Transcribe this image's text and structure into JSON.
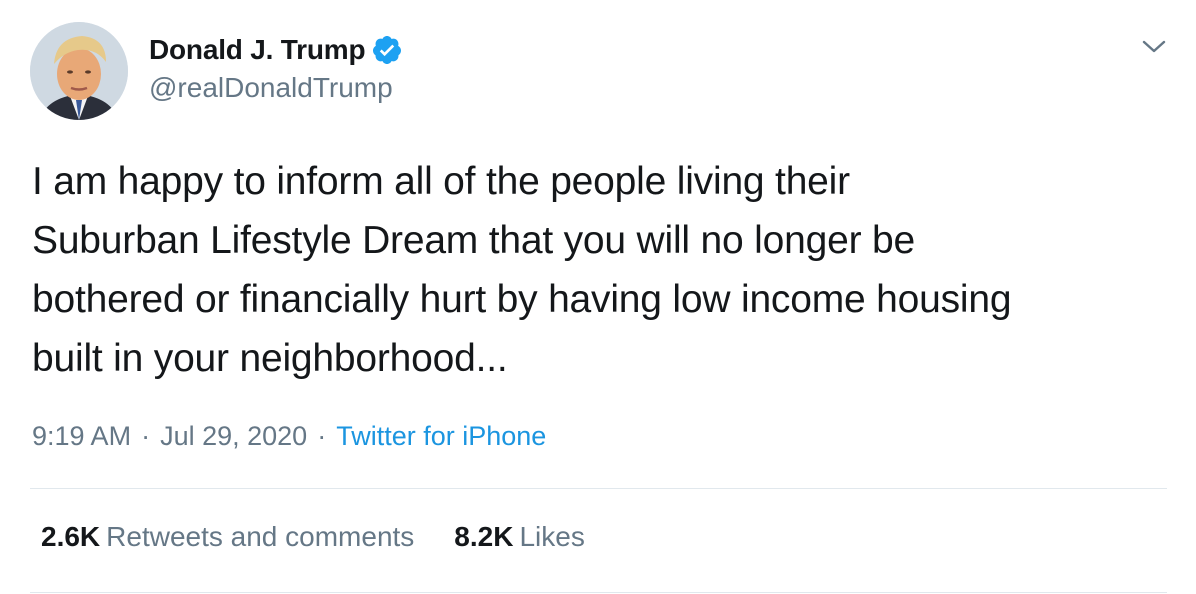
{
  "author": {
    "display_name": "Donald J. Trump",
    "handle": "@realDonaldTrump",
    "verified": true,
    "avatar_icon": "profile-photo"
  },
  "tweet": {
    "text_lines": [
      "I am happy to inform all of the people living their",
      "Suburban Lifestyle Dream that you will no longer be",
      "bothered or financially hurt by having low income housing",
      "built in your neighborhood..."
    ],
    "time": "9:19 AM",
    "separator": "·",
    "date": "Jul 29, 2020",
    "source": "Twitter for iPhone"
  },
  "stats": {
    "retweets_count": "2.6K",
    "retweets_label": "Retweets and comments",
    "likes_count": "8.2K",
    "likes_label": "Likes"
  },
  "icons": {
    "verified": "verified-badge-icon",
    "menu": "chevron-down-icon"
  },
  "colors": {
    "text": "#14171a",
    "secondary": "#657786",
    "link": "#1b95e0",
    "verified": "#1da1f2",
    "divider": "#e1e8ed"
  }
}
